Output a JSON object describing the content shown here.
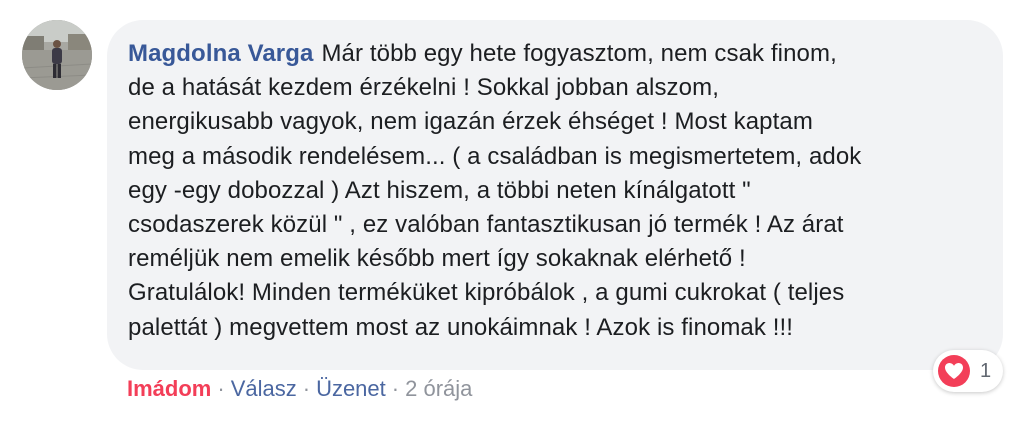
{
  "comment": {
    "author": "Magdolna Varga",
    "text_lines": [
      "Már több egy hete fogyasztom, nem csak finom,",
      "de a hatását kezdem érzékelni ! Sokkal jobban alszom,",
      "energikusabb vagyok, nem igazán érzek éhséget ! Most kaptam",
      "meg a második rendelésem... ( a családban is megismertetem, adok",
      "egy -egy dobozzal ) Azt hiszem, a többi neten kínálgatott \"",
      "csodaszerek közül \" , ez valóban fantasztikusan jó termék ! Az árat",
      "reméljük nem emelik később mert így sokaknak elérhető !",
      "Gratulálok! Minden terméküket kipróbálok , a gumi cukrokat ( teljes",
      "palettát ) megvettem most az unokáimnak ! Azok is finomak !!!"
    ]
  },
  "reaction": {
    "icon": "heart-icon",
    "count": "1",
    "color": "#f33e58"
  },
  "actions": {
    "love_label": "Imádom",
    "reply_label": "Válasz",
    "message_label": "Üzenet",
    "separator": "·",
    "timestamp": "2 órája"
  },
  "colors": {
    "author": "#385898",
    "bubble": "#f2f3f5",
    "love": "#f33e58",
    "link": "#4b67a1",
    "meta": "#90949c"
  }
}
